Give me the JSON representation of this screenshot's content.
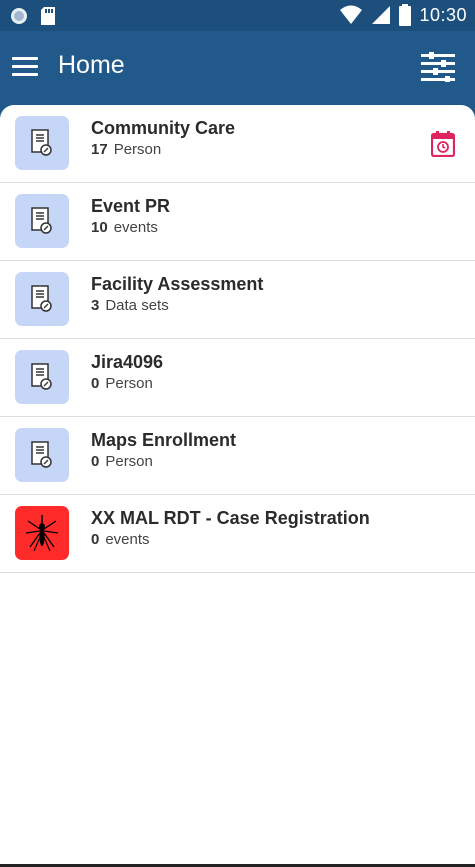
{
  "status_bar": {
    "time": "10:30",
    "icons": [
      "notification-dot-icon",
      "sd-card-icon",
      "wifi-icon",
      "signal-icon",
      "battery-icon"
    ]
  },
  "app_bar": {
    "title": "Home",
    "menu_icon": "hamburger-menu-icon",
    "filter_icon": "filter-sliders-icon"
  },
  "colors": {
    "status_bar_bg": "#1c4f7b",
    "app_bar_bg": "#215a8a",
    "program_icon_bg": "#c5d6f7",
    "malaria_icon_bg": "#ff2a2a",
    "calendar_icon": "#e0245e"
  },
  "programs": [
    {
      "title": "Community Care",
      "count": "17",
      "unit": "Person",
      "icon": "program-form-icon",
      "has_calendar": true
    },
    {
      "title": "Event PR",
      "count": "10",
      "unit": "events",
      "icon": "program-form-icon"
    },
    {
      "title": "Facility Assessment",
      "count": "3",
      "unit": "Data sets",
      "icon": "program-form-icon"
    },
    {
      "title": "Jira4096",
      "count": "0",
      "unit": "Person",
      "icon": "program-form-icon"
    },
    {
      "title": "Maps Enrollment",
      "count": "0",
      "unit": "Person",
      "icon": "program-form-icon"
    },
    {
      "title": "XX MAL RDT - Case Registration",
      "count": "0",
      "unit": "events",
      "icon": "mosquito-icon"
    }
  ]
}
